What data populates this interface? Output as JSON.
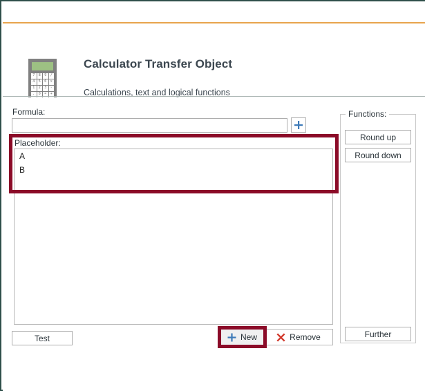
{
  "window": {
    "border_color": "#2f4f4a",
    "accent_color": "#e8a44d"
  },
  "header": {
    "title": "Calculator Transfer Object",
    "subtitle": "Calculations, text and logical functions",
    "icon": "calculator-icon",
    "icon_keys": [
      "7",
      "8",
      "9",
      "/",
      "4",
      "5",
      "6",
      "x",
      "1",
      "2",
      "3",
      "-",
      ".",
      "0",
      "=",
      "+"
    ],
    "icon_body_color": "#808080",
    "icon_screen_color": "#9dc183"
  },
  "formula": {
    "label": "Formula:",
    "value": "",
    "placeholder": "",
    "add_button_icon": "plus-icon"
  },
  "placeholder": {
    "label": "Placeholder:",
    "items": [
      "A",
      "B"
    ]
  },
  "actions": {
    "test_label": "Test",
    "new_label": "New",
    "new_icon": "plus-icon",
    "remove_label": "Remove",
    "remove_icon": "x-icon"
  },
  "functions": {
    "legend": "Functions:",
    "buttons": [
      {
        "label": "Round up"
      },
      {
        "label": "Round down"
      }
    ],
    "further_label": "Further"
  },
  "annotations": {
    "highlight_color": "#8b0b28",
    "targets": [
      "placeholder-group",
      "new-button"
    ]
  }
}
